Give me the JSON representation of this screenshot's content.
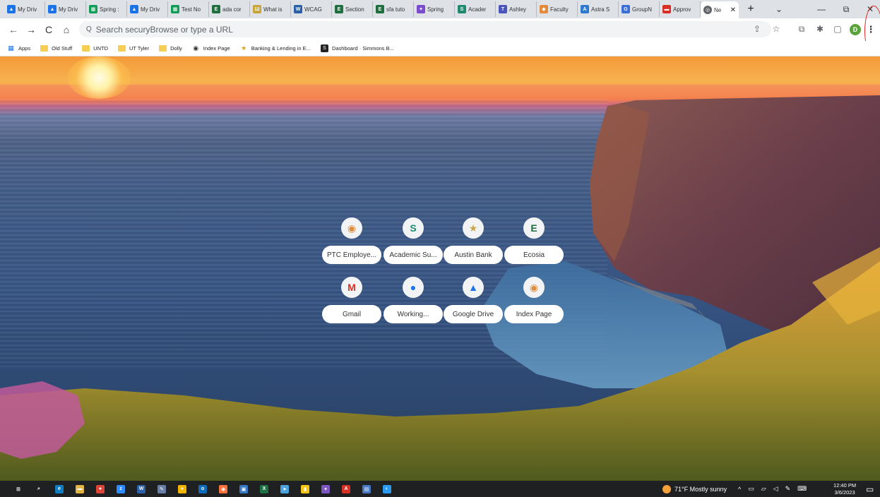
{
  "tabs": [
    {
      "label": "My Driv",
      "color": "#1a73e8",
      "glyph": "▲"
    },
    {
      "label": "My Driv",
      "color": "#1a73e8",
      "glyph": "▲"
    },
    {
      "label": "Spring :",
      "color": "#0f9d58",
      "glyph": "▦"
    },
    {
      "label": "My Driv",
      "color": "#1a73e8",
      "glyph": "▲"
    },
    {
      "label": "Test No",
      "color": "#0f9d58",
      "glyph": "▦"
    },
    {
      "label": "ada cor",
      "color": "#1e6e3e",
      "glyph": "E"
    },
    {
      "label": "What is",
      "color": "#c8a53c",
      "glyph": "Ш"
    },
    {
      "label": "WCAG",
      "color": "#2b5fa8",
      "glyph": "W"
    },
    {
      "label": "Section",
      "color": "#1e6e3e",
      "glyph": "E"
    },
    {
      "label": "sfa tuto",
      "color": "#1e6e3e",
      "glyph": "E"
    },
    {
      "label": "Spring",
      "color": "#7b4ccf",
      "glyph": "✦"
    },
    {
      "label": "Acader",
      "color": "#1f8a70",
      "glyph": "S"
    },
    {
      "label": "Ashley",
      "color": "#4b53bc",
      "glyph": "T"
    },
    {
      "label": "Faculty",
      "color": "#e48a3c",
      "glyph": "◆"
    },
    {
      "label": "Astra S",
      "color": "#2f7ad1",
      "glyph": "A"
    },
    {
      "label": "GroupN",
      "color": "#3b6fd8",
      "glyph": "G"
    },
    {
      "label": "Approv",
      "color": "#d93025",
      "glyph": "▬"
    }
  ],
  "active_tab": {
    "label": "Ne",
    "close": "✕"
  },
  "newtab": "+",
  "window_controls": {
    "minimize": "—",
    "restore": "⧉",
    "close": "✕",
    "chevron": "⌄"
  },
  "toolbar": {
    "back": "←",
    "forward": "→",
    "reload": "C",
    "home": "⌂",
    "search_icon": "Q",
    "omnibox_placeholder": "Search securyBrowse or type a URL",
    "share": "⇪",
    "star": "☆",
    "ext1": "⧉",
    "ext2": "✱",
    "sidepanel": "▢",
    "profile_initial": "D",
    "menu": "⋮"
  },
  "bookmarks": [
    {
      "label": "Apps",
      "kind": "apps"
    },
    {
      "label": "Old Stuff",
      "kind": "folder"
    },
    {
      "label": "UNTD",
      "kind": "folder"
    },
    {
      "label": "UT Tyler",
      "kind": "folder"
    },
    {
      "label": "Dolly",
      "kind": "folder"
    },
    {
      "label": "Index Page",
      "kind": "globe"
    },
    {
      "label": "Banking & Lending in E...",
      "kind": "star"
    },
    {
      "label": "Dashboard · Simmons B...",
      "kind": "dash"
    }
  ],
  "shortcuts": [
    {
      "label": "PTC Employe...",
      "glyph": "◉",
      "color": "#e08a3c"
    },
    {
      "label": "Academic Su...",
      "glyph": "S",
      "color": "#1f8a70"
    },
    {
      "label": "Austin Bank",
      "glyph": "★",
      "color": "#c9a646"
    },
    {
      "label": "Ecosia",
      "glyph": "E",
      "color": "#1e6e3e"
    },
    {
      "label": "Gmail",
      "glyph": "M",
      "color": "#d93025"
    },
    {
      "label": "Working...",
      "glyph": "●",
      "color": "#1a73e8"
    },
    {
      "label": "Google Drive",
      "glyph": "▲",
      "color": "#1a73e8"
    },
    {
      "label": "Index Page",
      "glyph": "◉",
      "color": "#e08a3c"
    }
  ],
  "taskbar": {
    "apps": [
      {
        "glyph": "⊞",
        "color": "#1f2022"
      },
      {
        "glyph": "⌕",
        "color": "#1f2022"
      },
      {
        "glyph": "e",
        "color": "#0f7dc2"
      },
      {
        "glyph": "▬",
        "color": "#e3b341"
      },
      {
        "glyph": "●",
        "color": "#db4437"
      },
      {
        "glyph": "z",
        "color": "#2d8cff"
      },
      {
        "glyph": "W",
        "color": "#2b5fa8"
      },
      {
        "glyph": "✎",
        "color": "#6a7fa8"
      },
      {
        "glyph": "●",
        "color": "#f4b400"
      },
      {
        "glyph": "o",
        "color": "#0f6cbd"
      },
      {
        "glyph": "◉",
        "color": "#ff7139"
      },
      {
        "glyph": "▣",
        "color": "#3578c6"
      },
      {
        "glyph": "X",
        "color": "#1e7145"
      },
      {
        "glyph": "➤",
        "color": "#4aa3df"
      },
      {
        "glyph": "▮",
        "color": "#f5c518"
      },
      {
        "glyph": "✦",
        "color": "#7e57c2"
      },
      {
        "glyph": "A",
        "color": "#d93025"
      },
      {
        "glyph": "▤",
        "color": "#4a79c4"
      },
      {
        "glyph": "◐",
        "color": "#2b9af3"
      }
    ],
    "weather": "71°F Mostly sunny",
    "time": "12:40 PM",
    "date": "3/6/2023"
  }
}
